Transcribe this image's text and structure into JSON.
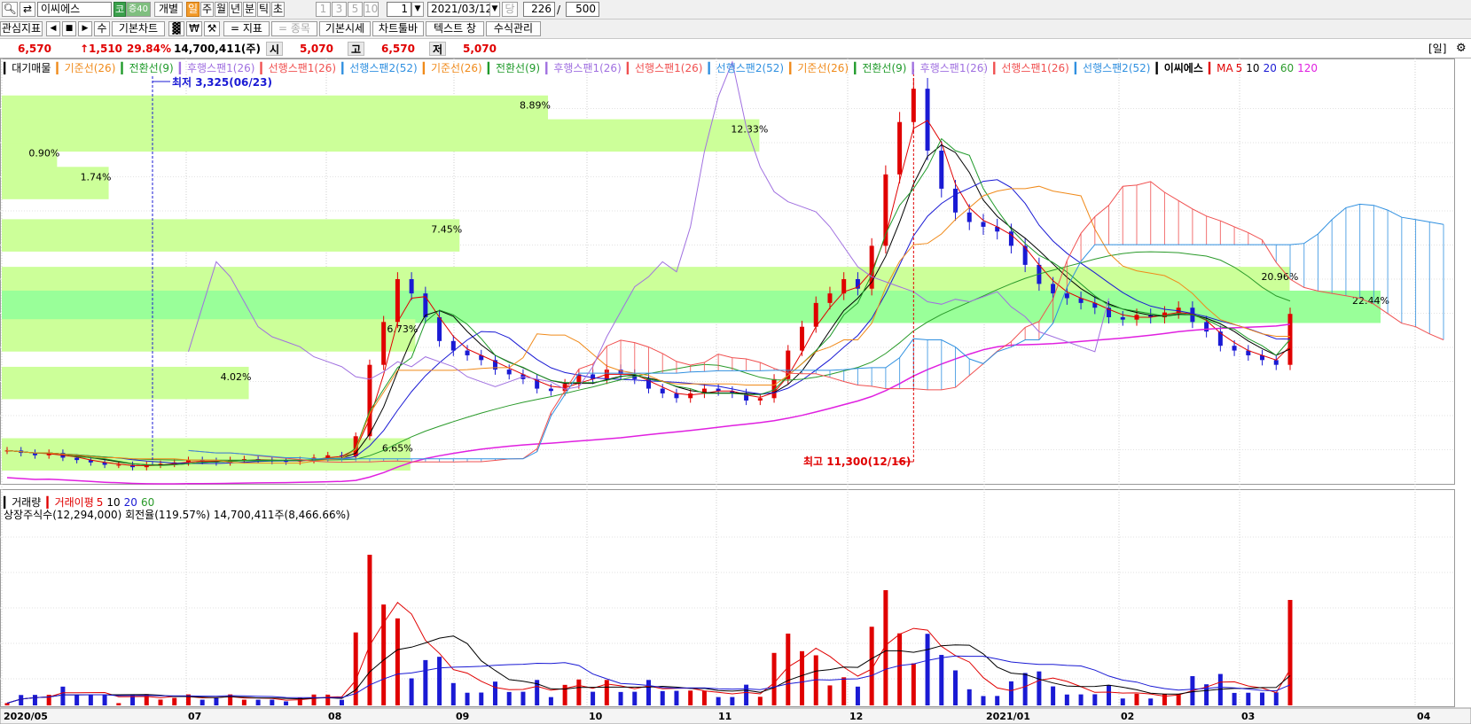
{
  "toolbar": {
    "stock_name": "이씨에스",
    "market_badge": "코",
    "margin_badge": "증40",
    "view_mode": "개별",
    "periods": [
      "일",
      "주",
      "월",
      "년",
      "분",
      "틱",
      "초"
    ],
    "active_period": "일",
    "intervals": [
      "1",
      "3",
      "5",
      "10"
    ],
    "interval_value": "1",
    "date": "2021/03/12",
    "date_unit": "당",
    "count_current": "226",
    "count_sep": "/",
    "count_total": "500"
  },
  "toolbar2": {
    "watch_indicator": "관심지표",
    "num_label": "수",
    "basic_chart": "기본차트",
    "indicator_label": "= 지표",
    "stock_label": "= 종목",
    "basic_quote": "기본시세",
    "chart_toolbar": "차트툴바",
    "text_window": "텍스트 창",
    "formula_manager": "수식관리"
  },
  "quote": {
    "price": "6,570",
    "change": "↑1,510",
    "change_pct": "29.84%",
    "volume": "14,700,411(주)",
    "open_label": "시",
    "open": "5,070",
    "high_label": "고",
    "high": "6,570",
    "low_label": "저",
    "low": "5,070",
    "period_tag": "[일]"
  },
  "colors": {
    "up": "#e00000",
    "down": "#1a1ad4",
    "base_line": "#f08a1a",
    "conversion_line": "#1f9a2a",
    "lagging_span": "#a070e0",
    "leading_span1": "#f05050",
    "leading_span2": "#3090e0",
    "ma5": "#e00000",
    "ma10": "#000000",
    "ma20": "#1a1ad4",
    "ma60": "#2a9a2a",
    "ma120": "#e020e0",
    "volume_profile": "#ccff99",
    "volume_profile_max": "#99ff99"
  },
  "price_panel": {
    "legend": [
      {
        "text": "대기매물",
        "color": "#000000",
        "marker": "#000000"
      },
      {
        "text": "기준선(26)",
        "color": "#f08a1a",
        "marker": "#f08a1a"
      },
      {
        "text": "전환선(9)",
        "color": "#1f9a2a",
        "marker": "#1f9a2a"
      },
      {
        "text": "후행스팬1(26)",
        "color": "#a070e0",
        "marker": "#a070e0"
      },
      {
        "text": "선행스팬1(26)",
        "color": "#f05050",
        "marker": "#f05050"
      },
      {
        "text": "선행스팬2(52)",
        "color": "#3090e0",
        "marker": "#3090e0"
      },
      {
        "text": "기준선(26)",
        "color": "#f08a1a",
        "marker": "#f08a1a"
      },
      {
        "text": "전환선(9)",
        "color": "#1f9a2a",
        "marker": "#1f9a2a"
      },
      {
        "text": "후행스팬1(26)",
        "color": "#a070e0",
        "marker": "#a070e0"
      },
      {
        "text": "선행스팬1(26)",
        "color": "#f05050",
        "marker": "#f05050"
      },
      {
        "text": "선행스팬2(52)",
        "color": "#3090e0",
        "marker": "#3090e0"
      },
      {
        "text": "기준선(26)",
        "color": "#f08a1a",
        "marker": "#f08a1a"
      },
      {
        "text": "전환선(9)",
        "color": "#1f9a2a",
        "marker": "#1f9a2a"
      },
      {
        "text": "후행스팬1(26)",
        "color": "#a070e0",
        "marker": "#a070e0"
      },
      {
        "text": "선행스팬1(26)",
        "color": "#f05050",
        "marker": "#f05050"
      },
      {
        "text": "선행스팬2(52)",
        "color": "#3090e0",
        "marker": "#3090e0"
      }
    ],
    "stock_legend": "이씨에스",
    "ma_label": "MA",
    "ma_periods": [
      {
        "text": "5",
        "color": "#e00000"
      },
      {
        "text": "10",
        "color": "#000000"
      },
      {
        "text": "20",
        "color": "#1a1ad4"
      },
      {
        "text": "60",
        "color": "#2a9a2a"
      },
      {
        "text": "120",
        "color": "#e020e0"
      }
    ],
    "low_annotation": "최저 3,325(06/23)",
    "high_annotation": "최고 11,300(12/16)"
  },
  "volume_panel": {
    "legend_volume": "거래량",
    "legend_avg": "거래이평",
    "ma_periods": [
      {
        "text": "5",
        "color": "#e00000"
      },
      {
        "text": "10",
        "color": "#000000"
      },
      {
        "text": "20",
        "color": "#1a1ad4"
      },
      {
        "text": "60",
        "color": "#2a9a2a"
      }
    ],
    "info": "상장주식수(12,294,000) 회전율(119.57%) 14,700,411주(8,466.66%)"
  },
  "chart_data": {
    "type": "candlestick",
    "title": "",
    "x_axis_labels": [
      "2020/05",
      "07",
      "08",
      "09",
      "10",
      "11",
      "12",
      "2021/01",
      "02",
      "03",
      "04"
    ],
    "price_range_approx": [
      3000,
      11600
    ],
    "volume_profile": [
      {
        "price_level": 10800,
        "pct": "8.89%"
      },
      {
        "price_level": 10300,
        "pct": "12.33%"
      },
      {
        "price_level": 9800,
        "pct": "0.90%"
      },
      {
        "price_level": 9300,
        "pct": "1.74%"
      },
      {
        "price_level": 8200,
        "pct": "7.45%"
      },
      {
        "price_level": 7200,
        "pct": "20.96%"
      },
      {
        "price_level": 6700,
        "pct": "22.44%"
      },
      {
        "price_level": 6100,
        "pct": "6.73%"
      },
      {
        "price_level": 5100,
        "pct": "4.02%"
      },
      {
        "price_level": 3600,
        "pct": "6.65%"
      }
    ],
    "close_series_approx": [
      3700,
      3650,
      3600,
      3650,
      3550,
      3500,
      3450,
      3400,
      3400,
      3350,
      3400,
      3420,
      3450,
      3500,
      3480,
      3450,
      3500,
      3520,
      3500,
      3480,
      3470,
      3500,
      3550,
      3600,
      3580,
      4000,
      5500,
      6400,
      7300,
      7000,
      6500,
      6000,
      5800,
      5700,
      5600,
      5400,
      5300,
      5200,
      5000,
      4950,
      5100,
      5300,
      5200,
      5400,
      5300,
      5200,
      5000,
      4900,
      4800,
      4900,
      5000,
      4950,
      4900,
      4750,
      4800,
      5200,
      5800,
      6300,
      6800,
      7000,
      7300,
      7100,
      8000,
      9500,
      10600,
      11300,
      10000,
      9200,
      8700,
      8500,
      8400,
      8300,
      8000,
      7600,
      7200,
      7000,
      6900,
      6800,
      6700,
      6500,
      6450,
      6550,
      6500,
      6600,
      6700,
      6400,
      6200,
      5900,
      5800,
      5700,
      5600,
      5500,
      6570
    ],
    "volume_series": "spikes near late Aug 2020 and mid Dec 2020; last bar 14,700,411",
    "moving_averages": [
      "MA5",
      "MA10",
      "MA20",
      "MA60",
      "MA120"
    ],
    "ichimoku": [
      "기준선(26)",
      "전환선(9)",
      "후행스팬1(26)",
      "선행스팬1(26)",
      "선행스팬2(52)"
    ],
    "annotations": [
      "최저 3,325(06/23)",
      "최고 11,300(12/16)"
    ]
  }
}
